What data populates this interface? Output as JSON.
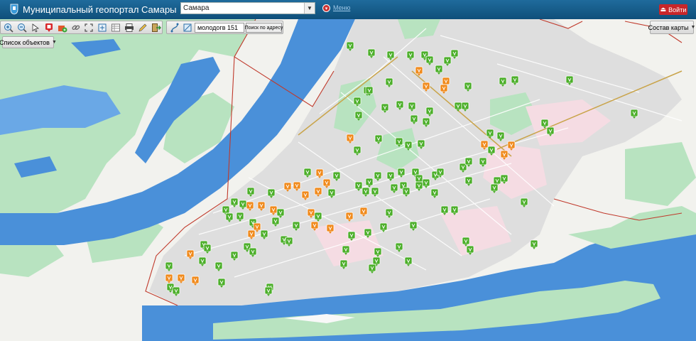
{
  "header": {
    "title": "Муниципальный геопортал Самары",
    "city_value": "Самара",
    "menu_label": "Меню",
    "login_label": "Войти"
  },
  "toolbar": {
    "tools": [
      "zoom-in-icon",
      "zoom-out-icon",
      "pointer-icon",
      "marker-icon",
      "add-object-icon",
      "link-icon",
      "fullscreen-icon",
      "extent-icon",
      "table-icon",
      "print-icon",
      "edit-icon",
      "exit-icon"
    ]
  },
  "search": {
    "value": "молодогв 151",
    "button_label": "Поиск по адресу"
  },
  "layers_label": "Состав карты",
  "objects_label": "Список объектов",
  "colors": {
    "header": "#16618f",
    "water": "#4a90d9",
    "green_zone": "#b8e3c0",
    "residential": "#f5dce3",
    "marker_green": "#4caf2a",
    "marker_orange": "#f08a1c",
    "boundary": "#c0392b"
  }
}
